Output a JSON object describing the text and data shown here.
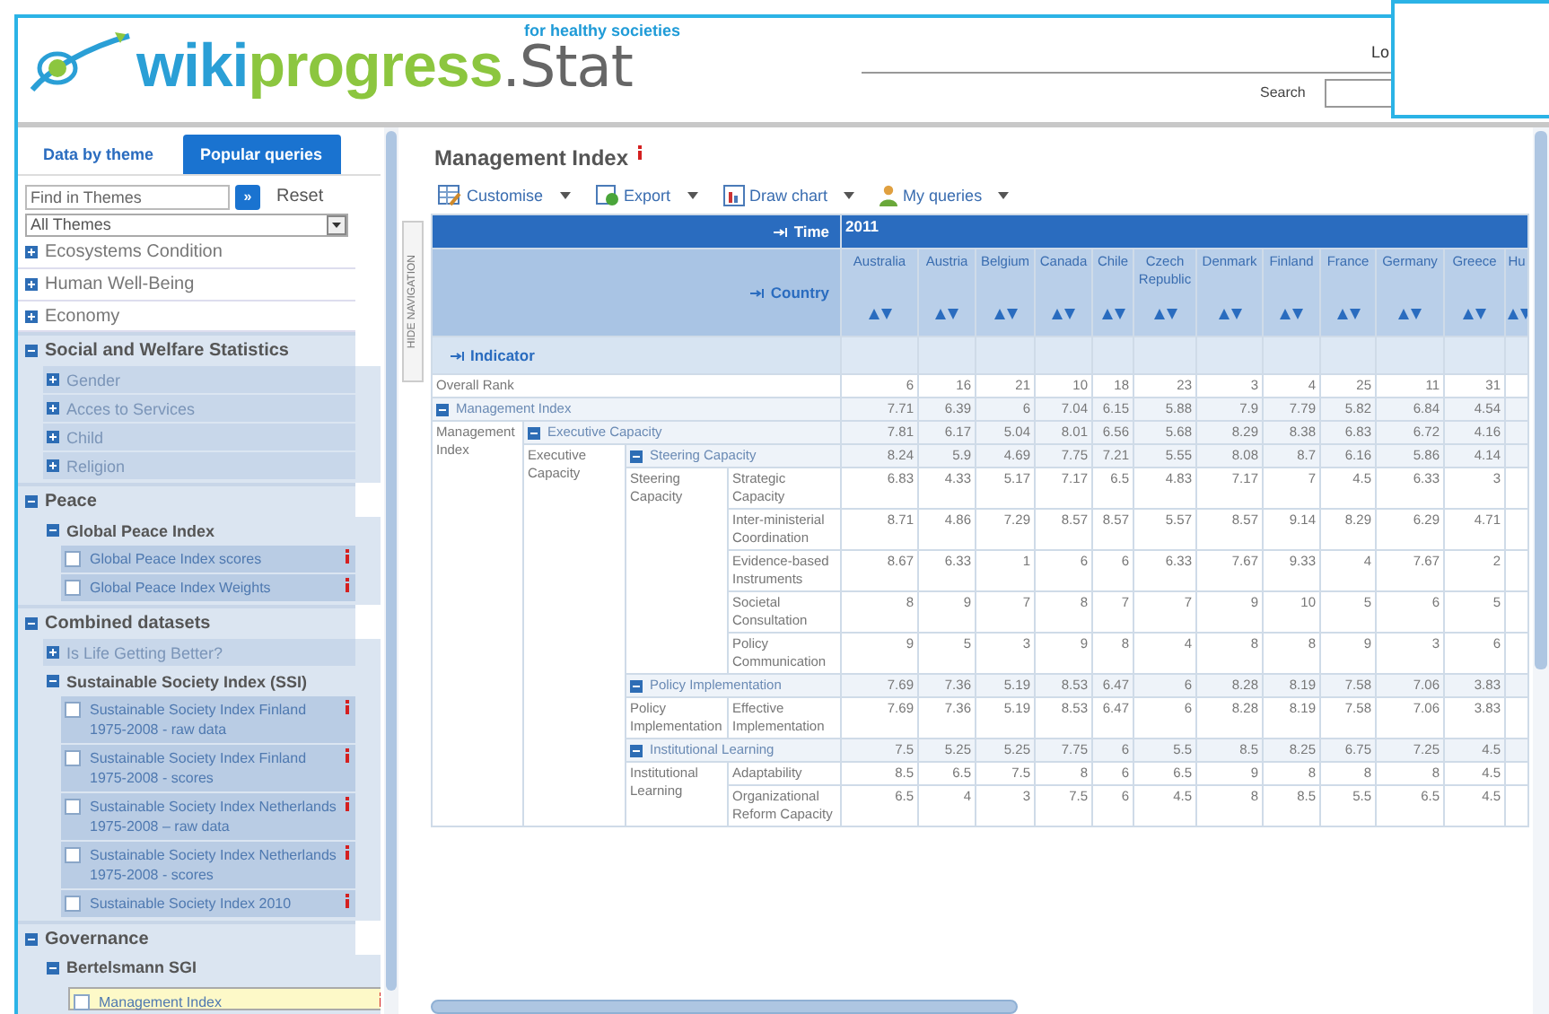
{
  "header": {
    "brand_first": "wiki",
    "brand_second": "progress",
    "brand_suffix": ".Stat",
    "tagline": "for healthy societies",
    "login_link": "Lo",
    "search_label": "Search"
  },
  "sidebar": {
    "tabs": [
      {
        "label": "Data by theme",
        "selected": true
      },
      {
        "label": "Popular queries",
        "selected": false
      }
    ],
    "find": {
      "placeholder": "Find in Themes",
      "button": "»",
      "reset": "Reset"
    },
    "theme_select": "All Themes",
    "themes": [
      {
        "label": "Ecosystems Condition",
        "expanded": false
      },
      {
        "label": "Human Well-Being",
        "expanded": false
      },
      {
        "label": "Economy",
        "expanded": false
      },
      {
        "label": "Social and Welfare Statistics",
        "expanded": true,
        "children": [
          {
            "label": "Gender",
            "expanded": false
          },
          {
            "label": "Acces to Services",
            "expanded": false
          },
          {
            "label": "Child",
            "expanded": false
          },
          {
            "label": "Religion",
            "expanded": false
          }
        ]
      },
      {
        "label": "Peace",
        "expanded": true,
        "children": [
          {
            "label": "Global Peace Index",
            "expanded": true,
            "children": [
              {
                "kind": "dataset",
                "label": "Global Peace Index scores",
                "checked": false,
                "selected": false
              },
              {
                "kind": "dataset",
                "label": "Global Peace Index Weights",
                "checked": false,
                "selected": false
              }
            ]
          }
        ]
      },
      {
        "label": "Combined datasets",
        "expanded": true,
        "children": [
          {
            "label": "Is Life Getting Better?",
            "expanded": false
          },
          {
            "label": "Sustainable Society Index (SSI)",
            "expanded": true,
            "children": [
              {
                "kind": "dataset",
                "label": "Sustainable Society Index Finland 1975-2008 - raw data",
                "checked": false,
                "selected": false
              },
              {
                "kind": "dataset",
                "label": "Sustainable Society Index Finland 1975-2008 - scores",
                "checked": false,
                "selected": false
              },
              {
                "kind": "dataset",
                "label": "Sustainable Society Index Netherlands 1975-2008 – raw data",
                "checked": false,
                "selected": false
              },
              {
                "kind": "dataset",
                "label": "Sustainable Society Index Netherlands 1975-2008 - scores",
                "checked": false,
                "selected": false
              },
              {
                "kind": "dataset",
                "label": "Sustainable Society Index 2010",
                "checked": false,
                "selected": false
              }
            ]
          }
        ]
      },
      {
        "label": "Governance",
        "expanded": true,
        "children": [
          {
            "label": "Bertelsmann SGI",
            "expanded": true,
            "children": [
              {
                "kind": "dataset",
                "label": "Management Index",
                "checked": false,
                "selected": true
              }
            ]
          }
        ]
      }
    ]
  },
  "hide_navigation": "HIDE NAVIGATION",
  "main": {
    "title": "Management Index",
    "toolbar": [
      {
        "kind": "customise",
        "label": "Customise"
      },
      {
        "kind": "export",
        "label": "Export"
      },
      {
        "kind": "chart",
        "label": "Draw chart"
      },
      {
        "kind": "queries",
        "label": "My queries"
      }
    ]
  },
  "table": {
    "time_label": "Time",
    "time_value": "2011",
    "country_label": "Country",
    "indicator_label": "Indicator",
    "countries": [
      "Australia",
      "Austria",
      "Belgium",
      "Canada",
      "Chile",
      "Czech Republic",
      "Denmark",
      "Finland",
      "France",
      "Germany",
      "Greece",
      "Hu"
    ],
    "indicators": [
      {
        "label": "Overall Rank",
        "values": [
          "6",
          "16",
          "21",
          "10",
          "18",
          "23",
          "3",
          "4",
          "25",
          "11",
          "31"
        ]
      },
      {
        "label": "Management Index",
        "expanded": true,
        "group_label": "Management Index",
        "values": [
          "7.71",
          "6.39",
          "6",
          "7.04",
          "6.15",
          "5.88",
          "7.9",
          "7.79",
          "5.82",
          "6.84",
          "4.54"
        ],
        "children": [
          {
            "label": "Executive Capacity",
            "expanded": true,
            "group_label": "Executive Capacity",
            "values": [
              "7.81",
              "6.17",
              "5.04",
              "8.01",
              "6.56",
              "5.68",
              "8.29",
              "8.38",
              "6.83",
              "6.72",
              "4.16"
            ],
            "children": [
              {
                "label": "Steering Capacity",
                "expanded": true,
                "group_label": "Steering Capacity",
                "values": [
                  "8.24",
                  "5.9",
                  "4.69",
                  "7.75",
                  "7.21",
                  "5.55",
                  "8.08",
                  "8.7",
                  "6.16",
                  "5.86",
                  "4.14"
                ],
                "children": [
                  {
                    "label": "Strategic Capacity",
                    "values": [
                      "6.83",
                      "4.33",
                      "5.17",
                      "7.17",
                      "6.5",
                      "4.83",
                      "7.17",
                      "7",
                      "4.5",
                      "6.33",
                      "3"
                    ]
                  },
                  {
                    "label": "Inter-ministerial Coordination",
                    "values": [
                      "8.71",
                      "4.86",
                      "7.29",
                      "8.57",
                      "8.57",
                      "5.57",
                      "8.57",
                      "9.14",
                      "8.29",
                      "6.29",
                      "4.71"
                    ]
                  },
                  {
                    "label": "Evidence-based Instruments",
                    "values": [
                      "8.67",
                      "6.33",
                      "1",
                      "6",
                      "6",
                      "6.33",
                      "7.67",
                      "9.33",
                      "4",
                      "7.67",
                      "2"
                    ]
                  },
                  {
                    "label": "Societal Consultation",
                    "values": [
                      "8",
                      "9",
                      "7",
                      "8",
                      "7",
                      "7",
                      "9",
                      "10",
                      "5",
                      "6",
                      "5"
                    ]
                  },
                  {
                    "label": "Policy Communication",
                    "values": [
                      "9",
                      "5",
                      "3",
                      "9",
                      "8",
                      "4",
                      "8",
                      "8",
                      "9",
                      "3",
                      "6"
                    ]
                  }
                ]
              },
              {
                "label": "Policy Implementation",
                "expanded": true,
                "group_label": "Policy Implementation",
                "values": [
                  "7.69",
                  "7.36",
                  "5.19",
                  "8.53",
                  "6.47",
                  "6",
                  "8.28",
                  "8.19",
                  "7.58",
                  "7.06",
                  "3.83"
                ],
                "children": [
                  {
                    "label": "Effective Implementation",
                    "values": [
                      "7.69",
                      "7.36",
                      "5.19",
                      "8.53",
                      "6.47",
                      "6",
                      "8.28",
                      "8.19",
                      "7.58",
                      "7.06",
                      "3.83"
                    ]
                  }
                ]
              },
              {
                "label": "Institutional Learning",
                "expanded": true,
                "group_label": "Institutional Learning",
                "values": [
                  "7.5",
                  "5.25",
                  "5.25",
                  "7.75",
                  "6",
                  "5.5",
                  "8.5",
                  "8.25",
                  "6.75",
                  "7.25",
                  "4.5"
                ],
                "children": [
                  {
                    "label": "Adaptability",
                    "values": [
                      "8.5",
                      "6.5",
                      "7.5",
                      "8",
                      "6",
                      "6.5",
                      "9",
                      "8",
                      "8",
                      "8",
                      "4.5"
                    ]
                  },
                  {
                    "label": "Organizational Reform Capacity",
                    "values": [
                      "6.5",
                      "4",
                      "3",
                      "7.5",
                      "6",
                      "4.5",
                      "8",
                      "8.5",
                      "5.5",
                      "6.5",
                      "4.5"
                    ]
                  }
                ]
              }
            ]
          }
        ]
      }
    ]
  }
}
